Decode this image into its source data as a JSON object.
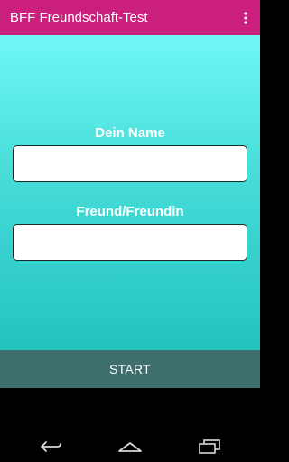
{
  "app_bar": {
    "title": "BFF Freundschaft-Test",
    "menu_icon": "overflow-menu-icon",
    "color": "#cb1f7d"
  },
  "form": {
    "name_label": "Dein Name",
    "name_value": "",
    "friend_label": "Freund/Freundin",
    "friend_value": ""
  },
  "start": {
    "label": "START",
    "color": "#3f6f6d"
  },
  "nav": {
    "back_icon": "back-icon",
    "home_icon": "home-icon",
    "recents_icon": "recents-icon"
  }
}
